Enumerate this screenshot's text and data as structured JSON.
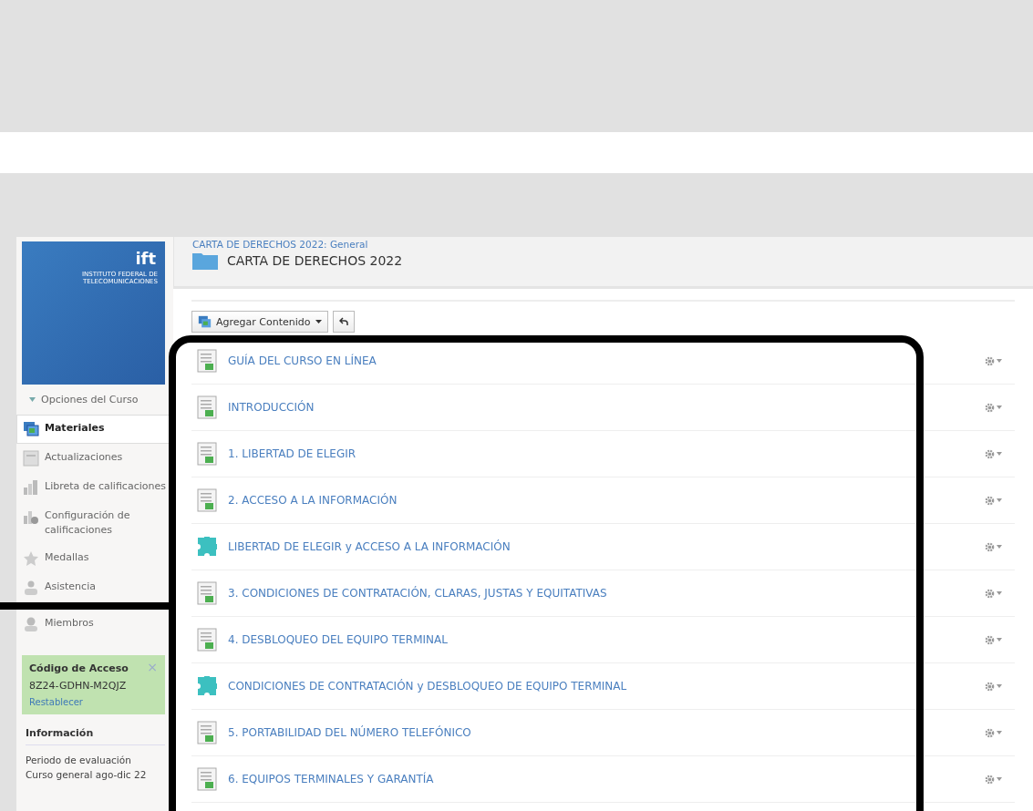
{
  "sidebar": {
    "banner": {
      "logo_text": "ift",
      "logo_subtext": "INSTITUTO FEDERAL DE TELECOMUNICACIONES"
    },
    "options_label": "Opciones del Curso",
    "items": [
      {
        "label": "Materiales",
        "kind": "materials",
        "selected": true
      },
      {
        "label": "Actualizaciones",
        "kind": "updates",
        "selected": false
      },
      {
        "label": "Libreta de calificaciones",
        "kind": "gradebook",
        "selected": false
      },
      {
        "label": "Configuración de calificaciones",
        "kind": "gradesetup",
        "selected": false
      },
      {
        "label": "Medallas",
        "kind": "badges",
        "selected": false
      },
      {
        "label": "Asistencia",
        "kind": "attendance",
        "selected": false
      },
      {
        "label": "Miembros",
        "kind": "members",
        "selected": false
      }
    ],
    "access_code": {
      "title": "Código de Acceso",
      "code": "8Z24-GDHN-M2QJZ",
      "reset": "Restablecer",
      "close": "×"
    },
    "info": {
      "title": "Información",
      "lines": [
        "Periodo de evaluación",
        "Curso general ago-dic 22"
      ]
    }
  },
  "header": {
    "breadcrumb": "CARTA DE DERECHOS 2022: General",
    "title": "CARTA DE DERECHOS 2022"
  },
  "toolbar": {
    "add_button": "Agregar Contenido"
  },
  "materials": [
    {
      "title": "GUÍA DEL CURSO EN LÍNEA",
      "kind": "document"
    },
    {
      "title": "INTRODUCCIÓN",
      "kind": "document"
    },
    {
      "title": "1. LIBERTAD DE ELEGIR",
      "kind": "document"
    },
    {
      "title": "2. ACCESO A LA INFORMACIÓN",
      "kind": "document"
    },
    {
      "title": "LIBERTAD DE ELEGIR y ACCESO A LA INFORMACIÓN",
      "kind": "puzzle"
    },
    {
      "title": "3. CONDICIONES DE CONTRATACIÓN, CLARAS, JUSTAS Y EQUITATIVAS",
      "kind": "document"
    },
    {
      "title": "4. DESBLOQUEO DEL EQUIPO TERMINAL",
      "kind": "document"
    },
    {
      "title": "CONDICIONES DE CONTRATACIÓN y DESBLOQUEO DE EQUIPO TERMINAL",
      "kind": "puzzle"
    },
    {
      "title": "5. PORTABILIDAD DEL NÚMERO TELEFÓNICO",
      "kind": "document"
    },
    {
      "title": "6. EQUIPOS TERMINALES Y GARANTÍA",
      "kind": "document"
    }
  ]
}
